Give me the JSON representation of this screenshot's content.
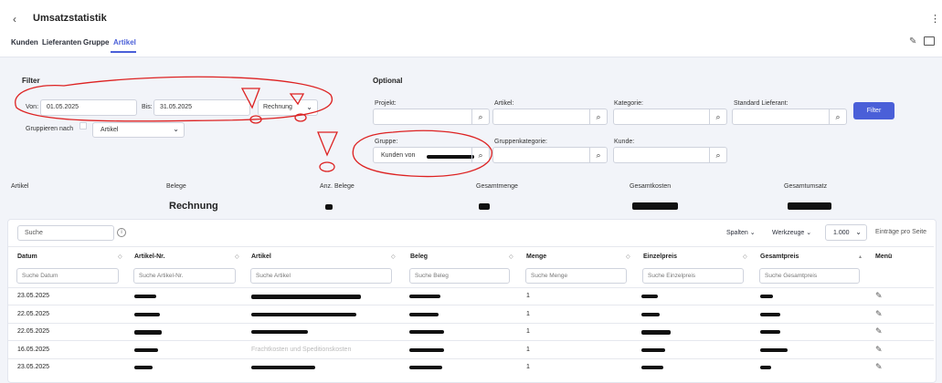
{
  "page": {
    "back_icon": "chevron-left-icon",
    "title": "Umsatzstatistik",
    "tabs": [
      {
        "label": "Kunden"
      },
      {
        "label": "Lieferanten"
      },
      {
        "label": "Gruppe"
      },
      {
        "label": "Artikel",
        "active": true
      }
    ]
  },
  "filter": {
    "heading": "Filter",
    "von_label": "Von:",
    "von_value": "01.05.2025",
    "bis_label": "Bis:",
    "bis_value": "31.05.2025",
    "type_value": "Rechnung",
    "group_label": "Gruppieren nach",
    "group_value": "Artikel"
  },
  "optional": {
    "heading": "Optional",
    "projekt_label": "Projekt:",
    "artikel_label": "Artikel:",
    "kategorie_label": "Kategorie:",
    "lieferant_label": "Standard Lieferant:",
    "gruppe_label": "Gruppe:",
    "gruppe_value": "Kunden von",
    "gruppenkategorie_label": "Gruppenkategorie:",
    "kunde_label": "Kunde:",
    "filter_button": "Filter"
  },
  "summary": {
    "headers": [
      "Artikel",
      "Belege",
      "Anz. Belege",
      "Gesamtmenge",
      "Gesamtkosten",
      "Gesamtumsatz"
    ],
    "belege_value": "Rechnung"
  },
  "table": {
    "search_placeholder": "Suche",
    "spalten": "Spalten",
    "werkzeuge": "Werkzeuge",
    "page_size": "1.000",
    "per_page_label": "Einträge pro Seite",
    "columns": [
      "Datum",
      "Artikel-Nr.",
      "Artikel",
      "Beleg",
      "Menge",
      "Einzelpreis",
      "Gesamtpreis",
      "Menü"
    ],
    "filter_placeholders": [
      "Suche Datum",
      "Suche Artikel-Nr.",
      "Suche Artikel",
      "Suche Beleg",
      "Suche Menge",
      "Suche Einzelpreis",
      "Suche Gesamtpreis"
    ],
    "rows": [
      {
        "datum": "23.05.2025",
        "menge": "1"
      },
      {
        "datum": "22.05.2025",
        "menge": "1"
      },
      {
        "datum": "22.05.2025",
        "menge": "1"
      },
      {
        "datum": "16.05.2025",
        "menge": "1"
      },
      {
        "datum": "23.05.2025",
        "menge": "1"
      }
    ],
    "redacted_partial": "Frachtkosten und Speditionskosten"
  }
}
